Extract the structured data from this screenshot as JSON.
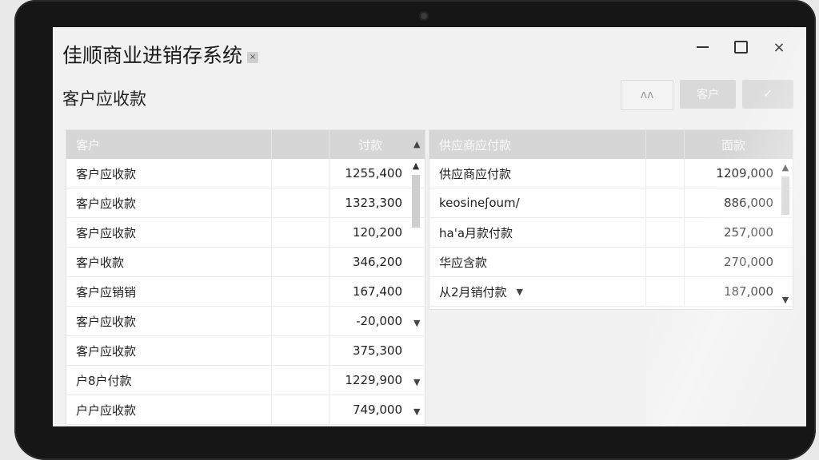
{
  "window": {
    "title": "佳顺商业进销存系统",
    "title_badge": "×",
    "controls": {
      "close": "×"
    }
  },
  "page_title": "客户应收款",
  "toolbar": [
    {
      "label": "ʌʌ"
    },
    {
      "label": "客户"
    },
    {
      "label": "✓"
    }
  ],
  "customer_table": {
    "columns": [
      "客户",
      "讨款"
    ],
    "rows": [
      {
        "name": "客户应收款",
        "amount": "1255,400"
      },
      {
        "name": "客户应收款",
        "amount": "1323,300"
      },
      {
        "name": "客户应收款",
        "amount": "120,200"
      },
      {
        "name": "客户收款",
        "amount": "346,200"
      },
      {
        "name": "客户应销销",
        "amount": "167,400"
      },
      {
        "name": "客户应收款",
        "amount": "-20,000"
      },
      {
        "name": "客户应收款",
        "amount": "375,300"
      },
      {
        "name": "户8户付款",
        "amount": "1229,900"
      },
      {
        "name": "户户应收款",
        "amount": "749,000"
      }
    ]
  },
  "supplier_table": {
    "columns": [
      "供应商应付款",
      "面款"
    ],
    "rows": [
      {
        "name": "供应商应付款",
        "amount": "1209,000"
      },
      {
        "name": "keosineʃoum/",
        "amount": "886,000"
      },
      {
        "name": "ha'a月款付款",
        "amount": "257,000"
      },
      {
        "name": "华应含款",
        "amount": "270,000"
      },
      {
        "name": "从2月销付款",
        "amount": "187,000"
      }
    ]
  },
  "icons": {
    "sort": "▲",
    "scroll_up": "▲",
    "scroll_down": "▼",
    "row_dropdown": "▼"
  },
  "colors": {
    "header_bg": "#d6d6d6",
    "screen_bg": "#f1f1f1",
    "bezel": "#161616"
  }
}
